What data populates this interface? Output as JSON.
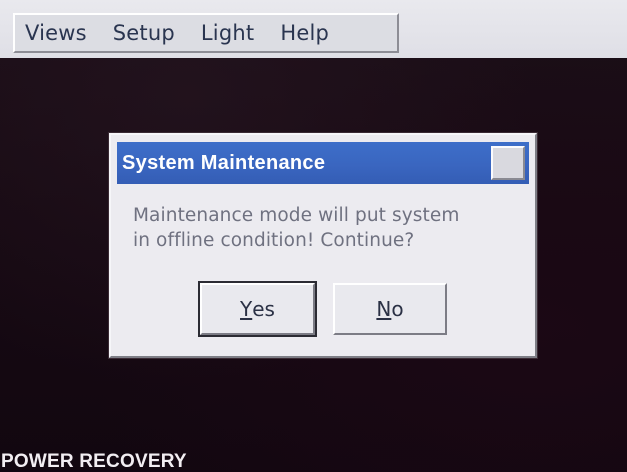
{
  "menubar": {
    "items": [
      {
        "label": "Views"
      },
      {
        "label": "Setup"
      },
      {
        "label": "Light"
      },
      {
        "label": "Help"
      }
    ]
  },
  "dialog": {
    "title": "System Maintenance",
    "message_line1": "Maintenance mode will put system",
    "message_line2": "in offline condition! Continue?",
    "buttons": {
      "yes": {
        "mnemonic": "Y",
        "rest": "es"
      },
      "no": {
        "mnemonic": "N",
        "rest": "o"
      }
    }
  },
  "status": {
    "text": "POWER RECOVERY"
  },
  "colors": {
    "titlebar": "#3a66c0",
    "background": "#170a13",
    "dialog": "#ecebf0"
  }
}
